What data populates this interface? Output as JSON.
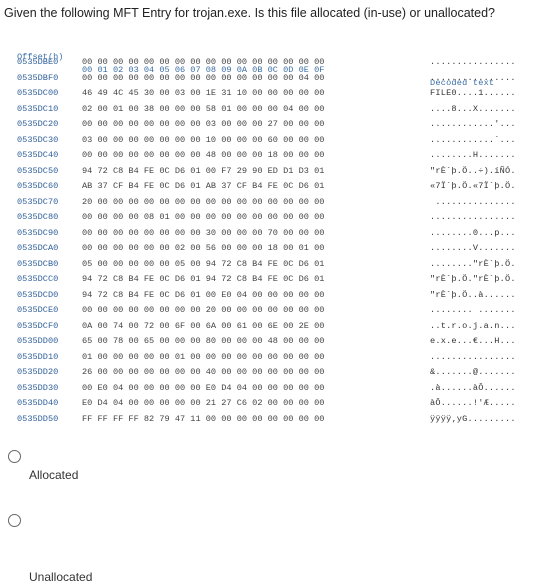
{
  "question": "Given the following MFT Entry for trojan.exe.  Is this file allocated (in-use) or unallocated?",
  "hex_view": {
    "header": {
      "offset": "Offset(h)",
      "bytes": "00 01 02 03 04 05 06 07 08 09 0A 0B 0C 0D 0E 0F",
      "decoded": "Decoded text"
    },
    "rows": [
      {
        "offset": "0535DBE0",
        "bytes": "00 00 00 00 00 00 00 00 00 00 00 00 00 00 00 00",
        "decoded": "................"
      },
      {
        "offset": "0535DBF0",
        "bytes": "00 00 00 00 00 00 00 00 00 00 00 00 00 00 04 00",
        "decoded": "................"
      },
      {
        "offset": "0535DC00",
        "bytes": "46 49 4C 45 30 00 03 00 1E 31 10 00 00 00 00 00",
        "decoded": "FILE0....1......"
      },
      {
        "offset": "0535DC10",
        "bytes": "02 00 01 00 38 00 00 00 58 01 00 00 00 04 00 00",
        "decoded": "....8...X......."
      },
      {
        "offset": "0535DC20",
        "bytes": "00 00 00 00 00 00 00 00 03 00 00 00 27 00 00 00",
        "decoded": "............'..."
      },
      {
        "offset": "0535DC30",
        "bytes": "03 00 00 00 00 00 00 00 10 00 00 00 60 00 00 00",
        "decoded": "............`..."
      },
      {
        "offset": "0535DC40",
        "bytes": "00 00 00 00 00 00 00 00 48 00 00 00 18 00 00 00",
        "decoded": "........H......."
      },
      {
        "offset": "0535DC50",
        "bytes": "94 72 C8 B4 FE 0C D6 01 00 F7 29 90 ED D1 D3 01",
        "decoded": "\"rÈ´þ.Ö..÷).íÑÓ."
      },
      {
        "offset": "0535DC60",
        "bytes": "AB 37 CF B4 FE 0C D6 01 AB 37 CF B4 FE 0C D6 01",
        "decoded": "«7Ï´þ.Ö.«7Ï´þ.Ö."
      },
      {
        "offset": "0535DC70",
        "bytes": "20 00 00 00 00 00 00 00 00 00 00 00 00 00 00 00",
        "decoded": " ..............."
      },
      {
        "offset": "0535DC80",
        "bytes": "00 00 00 00 08 01 00 00 00 00 00 00 00 00 00 00",
        "decoded": "................"
      },
      {
        "offset": "0535DC90",
        "bytes": "00 00 00 00 00 00 00 00 30 00 00 00 70 00 00 00",
        "decoded": "........0...p..."
      },
      {
        "offset": "0535DCA0",
        "bytes": "00 00 00 00 00 00 02 00 56 00 00 00 18 00 01 00",
        "decoded": "........V......."
      },
      {
        "offset": "0535DCB0",
        "bytes": "05 00 00 00 00 00 05 00 94 72 C8 B4 FE 0C D6 01",
        "decoded": "........\"rÈ´þ.Ö."
      },
      {
        "offset": "0535DCC0",
        "bytes": "94 72 C8 B4 FE 0C D6 01 94 72 C8 B4 FE 0C D6 01",
        "decoded": "\"rÈ´þ.Ö.\"rÈ´þ.Ö."
      },
      {
        "offset": "0535DCD0",
        "bytes": "94 72 C8 B4 FE 0C D6 01 00 E0 04 00 00 00 00 00",
        "decoded": "\"rÈ´þ.Ö..à......"
      },
      {
        "offset": "0535DCE0",
        "bytes": "00 00 00 00 00 00 00 00 20 00 00 00 00 00 00 00",
        "decoded": "........ ......."
      },
      {
        "offset": "0535DCF0",
        "bytes": "0A 00 74 00 72 00 6F 00 6A 00 61 00 6E 00 2E 00",
        "decoded": "..t.r.o.j.a.n..."
      },
      {
        "offset": "0535DD00",
        "bytes": "65 00 78 00 65 00 00 00 80 00 00 00 48 00 00 00",
        "decoded": "e.x.e...€...H..."
      },
      {
        "offset": "0535DD10",
        "bytes": "01 00 00 00 00 00 01 00 00 00 00 00 00 00 00 00",
        "decoded": "................"
      },
      {
        "offset": "0535DD20",
        "bytes": "26 00 00 00 00 00 00 00 40 00 00 00 00 00 00 00",
        "decoded": "&.......@......."
      },
      {
        "offset": "0535DD30",
        "bytes": "00 E0 04 00 00 00 00 00 E0 D4 04 00 00 00 00 00",
        "decoded": ".à......àÔ......"
      },
      {
        "offset": "0535DD40",
        "bytes": "E0 D4 04 00 00 00 00 00 21 27 C6 02 00 00 00 00",
        "decoded": "àÔ......!'Æ....."
      },
      {
        "offset": "0535DD50",
        "bytes": "FF FF FF FF 82 79 47 11 00 00 00 00 00 00 00 00",
        "decoded": "ÿÿÿÿ‚yG........."
      }
    ]
  },
  "options": [
    {
      "label": "Allocated"
    },
    {
      "label": "Unallocated"
    }
  ]
}
